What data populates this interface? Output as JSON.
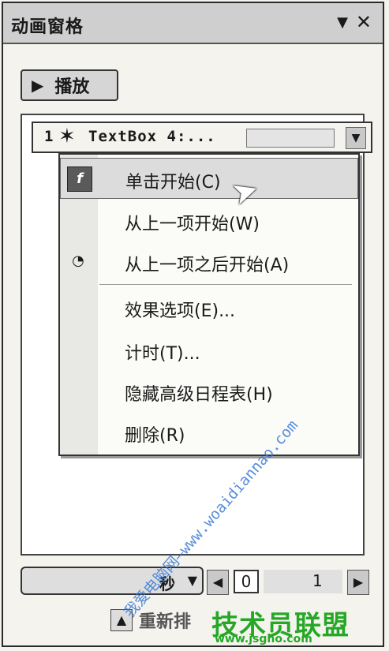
{
  "pane": {
    "title": "动画窗格",
    "dropdown_glyph": "▼",
    "close_glyph": "✕"
  },
  "play_button": {
    "icon": "play-icon",
    "label": "播放"
  },
  "animation_list": {
    "items": [
      {
        "number": "1",
        "icon": "star-effect-icon",
        "text": "TextBox 4:..."
      }
    ]
  },
  "context_menu": {
    "items": [
      {
        "label": "单击开始(C)",
        "icon": "click-icon",
        "selected": true
      },
      {
        "label": "从上一项开始(W)",
        "icon": ""
      },
      {
        "label": "从上一项之后开始(A)",
        "icon": "clock-icon"
      },
      {
        "label": "效果选项(E)...",
        "icon": ""
      },
      {
        "label": "计时(T)...",
        "icon": ""
      },
      {
        "label": "隐藏高级日程表(H)",
        "icon": ""
      },
      {
        "label": "删除(R)",
        "icon": ""
      }
    ]
  },
  "timeline": {
    "speed_label": "秒",
    "start": "0",
    "end": "1"
  },
  "reorder": {
    "label": "重新排"
  },
  "watermark": {
    "site_name": "技术员联盟",
    "site_url": "www.jsgho.com",
    "diagonal": "我爱电脑网—www.woaidiannao.com"
  }
}
